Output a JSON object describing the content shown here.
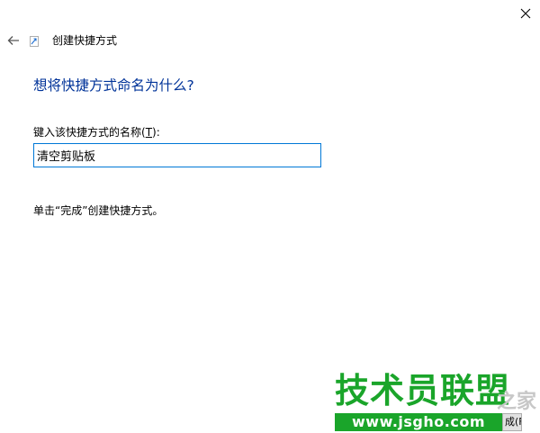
{
  "window": {
    "title": "创建快捷方式"
  },
  "page": {
    "heading": "想将快捷方式命名为什么?",
    "field_label_prefix": "键入该快捷方式的名称(",
    "field_label_accel": "T",
    "field_label_suffix": "):",
    "name_value": "清空剪贴板",
    "hint": "单击“完成”创建快捷方式。"
  },
  "watermark": {
    "main": "技术员联盟",
    "side": "之家",
    "url": "www.jsgho.com"
  },
  "footer": {
    "finish_peek": "成(F)"
  },
  "icons": {
    "close": "close-icon",
    "back": "back-arrow-icon",
    "wizard": "shortcut-wizard-icon"
  },
  "colors": {
    "heading": "#003399",
    "input_border": "#0078d7",
    "watermark_green": "#1aa52a"
  }
}
